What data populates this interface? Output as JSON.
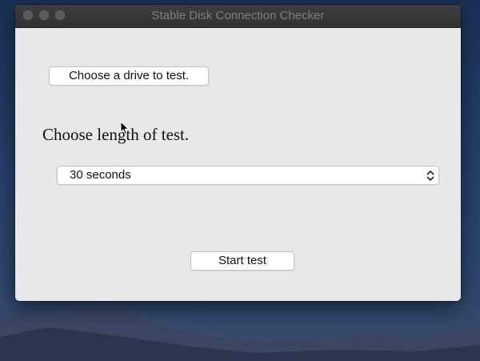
{
  "window": {
    "title": "Stable Disk Connection Checker"
  },
  "titlebar": {
    "buttons": [
      "close",
      "minimize",
      "zoom"
    ],
    "button_color": "#5a5a5c"
  },
  "drive": {
    "button_label": "Choose a drive to test."
  },
  "test_length": {
    "label": "Choose length of test.",
    "selected": "30 seconds"
  },
  "actions": {
    "start_label": "Start test"
  },
  "icons": {
    "select_chevron": "chevron-up-down-icon",
    "cursor": "mouse-pointer-icon"
  },
  "colors": {
    "window_bg": "#e8e7ea",
    "titlebar_bg": "#3a3a3c",
    "title_text": "#808083",
    "desktop_bg": "#25406a"
  }
}
